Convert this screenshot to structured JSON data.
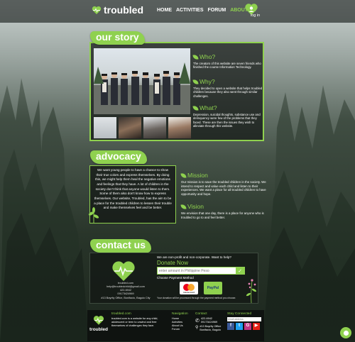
{
  "nav": {
    "logo_text": "troubled",
    "links": [
      "HOME",
      "ACTIVITIES",
      "FORUM",
      "ABOUT US"
    ],
    "active_index": 3,
    "login_label": "log in"
  },
  "story": {
    "badge": "our story",
    "who_title": "Who?",
    "who_text": "The creators of this website are seven friends who finished the course Information Technology.",
    "why_title": "Why?",
    "why_text": "They decided to open a website that helps troubled children because they also went through similar challenges.",
    "what_title": "What?",
    "what_text": "Depression, suicidal thoughts, substance use and delinquency were few of the problems that they faced. These are then the issues they wish to alleviate through this website."
  },
  "advocacy": {
    "badge": "advocacy",
    "text": "We want young people to have a chance to show their true colors and express themselves. By doing this, we might help them heal the negative emotions and feelings that they have. A lot of children in the society don't think that anyone would listen to them. Some of them also don't know how to express themselves. Our website, Troubled, has the aim to be a place for the troubled children to lessen their trouble and make themselves feel and be better.",
    "mission_title": "Mission",
    "mission_text": "Our mission is to save the troubled children in the society. We intend to respect and value each child and listen to their experiences. We want a place for all troubled children to have opportunity and hope.",
    "vision_title": "Vision",
    "vision_text": "We envision that one day, there is a place for anyone who is troubled to go to and feel better."
  },
  "contact": {
    "badge": "contact us",
    "site": "troubled.com",
    "email": "help@troubledchild@gmail.com",
    "phone1": "422-6942",
    "phone2": "09173424969",
    "address": "#13 Bayrity Office, Bonifacio, Baguio City",
    "intro": "We are non-profit and non-corporate. Want to help?",
    "donate_title": "Donate Now",
    "donate_placeholder": "enter amount in Philippine Peso",
    "payment_label": "Choose Payment Method",
    "pay1": "mastercard",
    "pay2": "PayPal",
    "note": "Your donation will be processed through the payment method you choose."
  },
  "footer": {
    "logo_text": "troubled",
    "site_title": "troubled.com",
    "about": "troubled.com is a website for any child, adolescent or teen to unwind and free themselves of challenges they face.",
    "nav_title": "Navigation",
    "nav_links": [
      "Home",
      "Activities",
      "About Us",
      "Forum"
    ],
    "contact_title": "Contact",
    "contact_phone1": "422-6942",
    "contact_phone2": "09173424969",
    "contact_addr1": "#13 Bayrity Office",
    "contact_addr2": "Bonifacio, Baguio",
    "stay_title": "Stay Connected",
    "email_placeholder": "email address"
  },
  "colors": {
    "accent": "#8fd14f",
    "panel": "#121614"
  }
}
